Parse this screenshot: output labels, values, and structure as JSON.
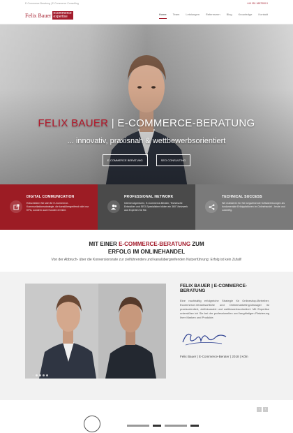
{
  "topbar": {
    "left": "E-Commerce Beratung | E-Commerce Consulting",
    "right": "+49 151 1657000 0"
  },
  "logo": {
    "name": "Felix Bauer",
    "tag_line1": "ecommerce",
    "tag_line2": "expertise"
  },
  "nav": {
    "items": [
      "Home",
      "Team",
      "Leistungen",
      "Referenzen",
      "Blog",
      "Knowledge",
      "Kontakt"
    ],
    "active": "Home"
  },
  "hero": {
    "title_red": "FELIX BAUER",
    "title_white": "| E-COMMERCE-BERATUNG",
    "subtitle": "... innovativ, praxisnah & wettbewerbsorientiert",
    "buttons": [
      "E-COMMERCE BERATUNG",
      "SEO CONSULTING"
    ]
  },
  "features": [
    {
      "title": "DIGITAL COMMUNICATION",
      "text": "Entscheiden Sie sich für E-Commerce-Kommunikationsstrategie, die kanalübergreifend nicht nur KPIs, sondern auch Kunden erreicht.",
      "icon": "share-square-icon"
    },
    {
      "title": "PROFESSIONAL NETWORK",
      "text": "Internet-Agenturen, E-Commerce-Berater, Technische Entwickler und SEO-Spezialisten bilden ein 360°-Netzwerk aus Experten für Sie.",
      "icon": "users-icon"
    },
    {
      "title": "TECHNICAL SUCCESS",
      "text": "Wir realisieren für Sie wegweisende Softwarelösungen als fundamentale Erfolgsfaktoren im Onlinehandel - heute und zukünftig.",
      "icon": "share-icon"
    }
  ],
  "mid": {
    "title_line1_pre": "MIT EINER",
    "title_line1_red": "E-COMMERCE-BERATUNG",
    "title_line1_post": "ZUM",
    "title_line2": "ERFOLG IM ONLINEHANDEL",
    "text": "Von der Abbruch- über die Konversionsrate zur zielführenden und kanalübergreifenden Nutzerführung: Erfolg ist kein Zufall!"
  },
  "about": {
    "title": "FELIX BAUER | E-COMMERCE-BERATUNG",
    "text": "Eine nachhaltig erfolgreiche Strategie für Onlineshop-Betreiber, Ecommerce-Verantwortliche und Onlinemarketing-Manager ist praxisorientiert, zielfokussiert und wettbewerbsorientiert. Mit Expertise unterstütze ich Sie bei der professionellen und langfristigen Platzierung Ihrer Marken und Produkte.",
    "caption": "Felix Bauer | E-Commerce-Berater | 2018 | Köln"
  },
  "colors": {
    "brand_red": "#a31c2c",
    "feature_red": "#9c1c24",
    "feature_dark": "#4a4a4a",
    "feature_grey": "#7a7a7a"
  }
}
